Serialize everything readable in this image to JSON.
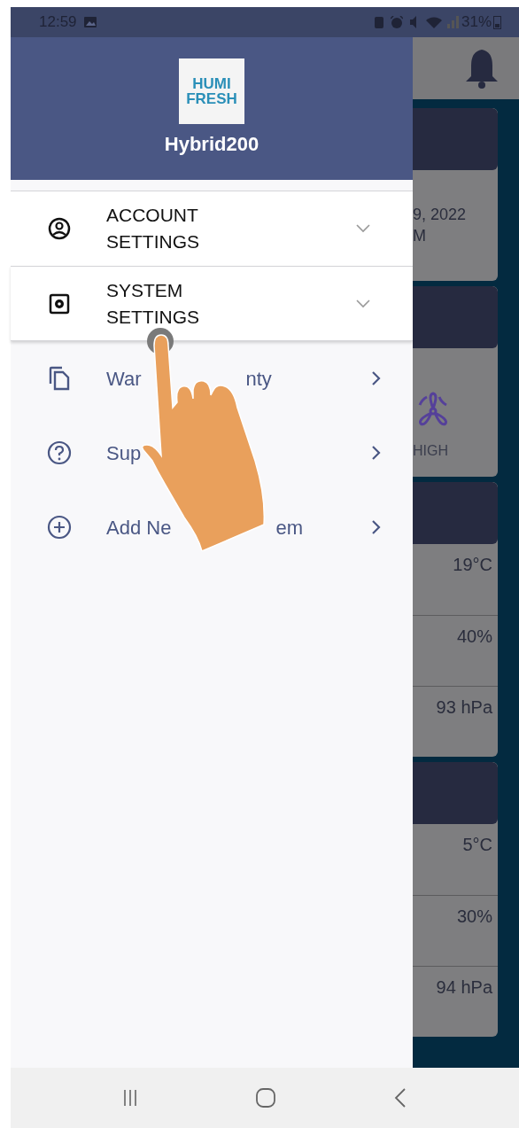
{
  "status_bar": {
    "time": "12:59",
    "battery": "31%"
  },
  "drawer": {
    "logo": {
      "line_1": "HUMI",
      "line_2": "FRESH"
    },
    "device_name": "Hybrid200",
    "items": [
      {
        "kind": "accordion",
        "label": "ACCOUNT SETTINGS",
        "expanded": false
      },
      {
        "kind": "accordion",
        "label": "SYSTEM SETTINGS",
        "expanded": false
      },
      {
        "kind": "link",
        "label": "War",
        "label_tail": "nty"
      },
      {
        "kind": "link",
        "label": "Sup"
      },
      {
        "kind": "link",
        "label": "Add Ne",
        "label_tail": "em"
      }
    ]
  },
  "tap_hint": {
    "kind": "hand"
  },
  "background": {
    "cards": [
      {
        "kind": "text",
        "lines": [
          "9, 2022",
          "M"
        ]
      },
      {
        "kind": "fan",
        "label": "HIGH"
      },
      {
        "kind": "readings",
        "rows": [
          "19°C",
          "40%",
          "93 hPa"
        ]
      },
      {
        "kind": "readings",
        "rows": [
          "5°C",
          "30%",
          "94 hPa"
        ]
      }
    ]
  }
}
